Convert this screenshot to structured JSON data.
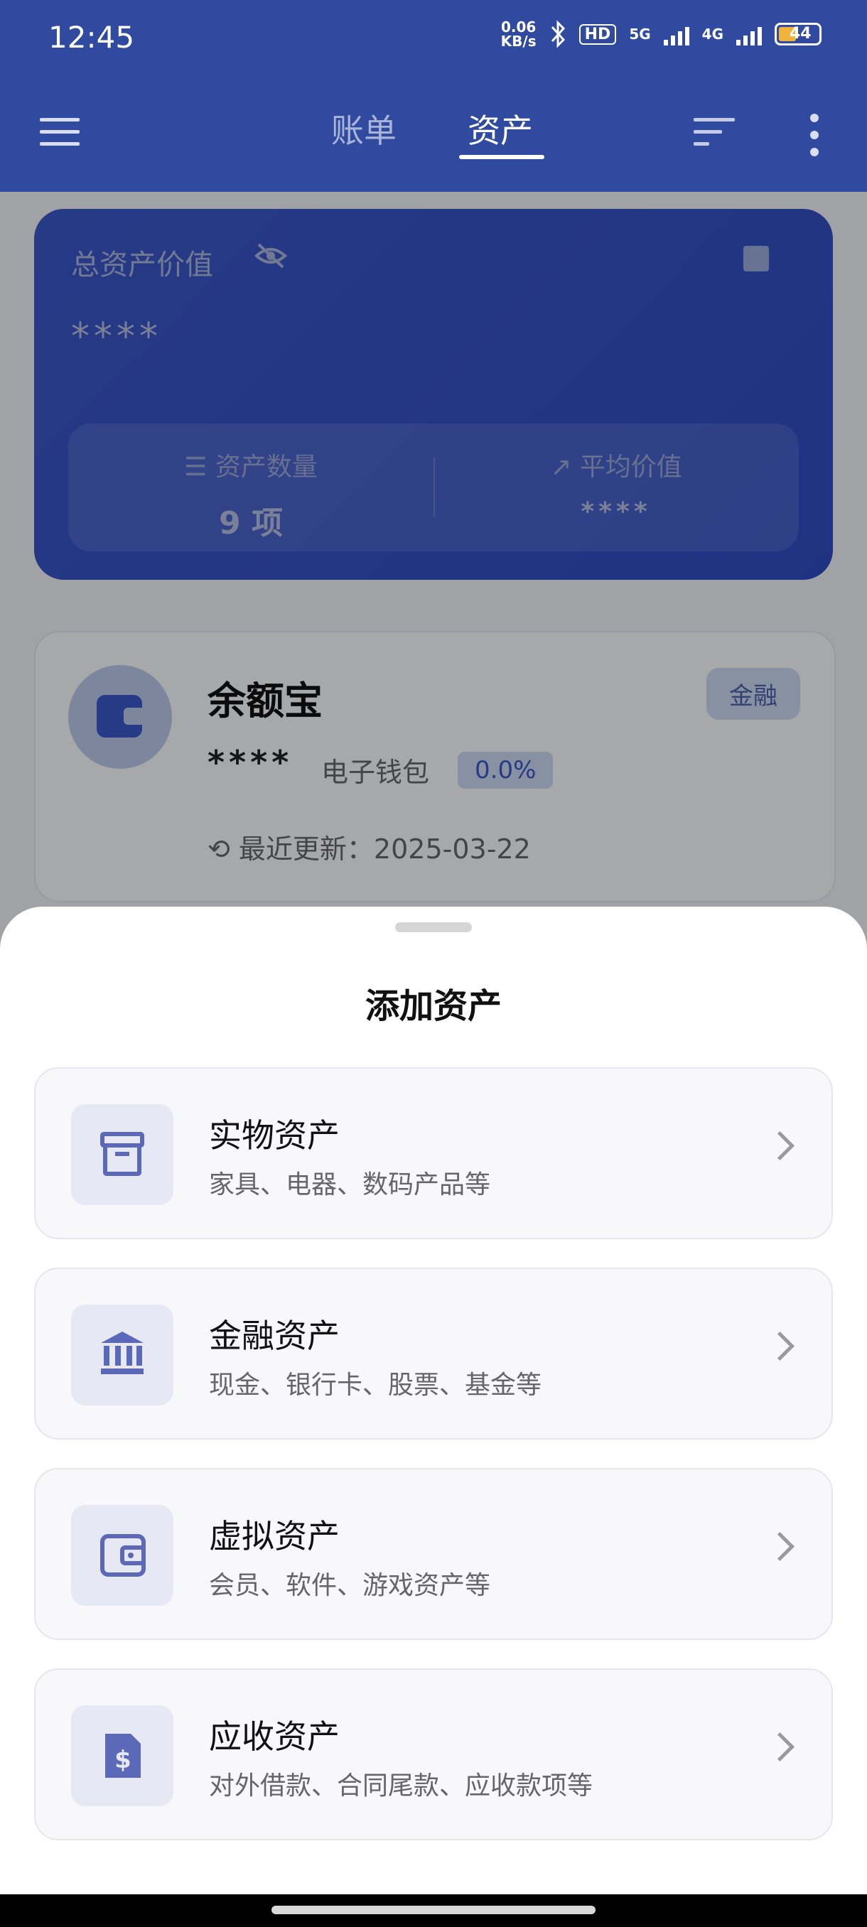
{
  "status_bar": {
    "time": "12:45",
    "net_speed_value": "0.06",
    "net_speed_unit": "KB/s",
    "hd_label": "HD",
    "net1": "5G",
    "net2": "4G",
    "battery": "44"
  },
  "header": {
    "tabs": [
      {
        "label": "账单",
        "active": false
      },
      {
        "label": "资产",
        "active": true
      }
    ]
  },
  "summary": {
    "title": "总资产价值",
    "value": "****",
    "count_label": "资产数量",
    "count_value": "9 项",
    "avg_label": "平均价值",
    "avg_value": "****"
  },
  "asset_card": {
    "name": "余额宝",
    "tag": "金融",
    "value": "****",
    "type": "电子钱包",
    "percent": "0.0%",
    "updated": "最近更新：2025-03-22"
  },
  "sheet": {
    "title": "添加资产",
    "options": [
      {
        "title": "实物资产",
        "subtitle": "家具、电器、数码产品等",
        "icon": "archive-box-icon"
      },
      {
        "title": "金融资产",
        "subtitle": "现金、银行卡、股票、基金等",
        "icon": "bank-icon"
      },
      {
        "title": "虚拟资产",
        "subtitle": "会员、软件、游戏资产等",
        "icon": "wallet-icon"
      },
      {
        "title": "应收资产",
        "subtitle": "对外借款、合同尾款、应收款项等",
        "icon": "invoice-dollar-icon"
      }
    ]
  },
  "colors": {
    "primary": "#2f4a9e",
    "card": "#3a56c6",
    "icon_accent": "#5c68b8"
  }
}
